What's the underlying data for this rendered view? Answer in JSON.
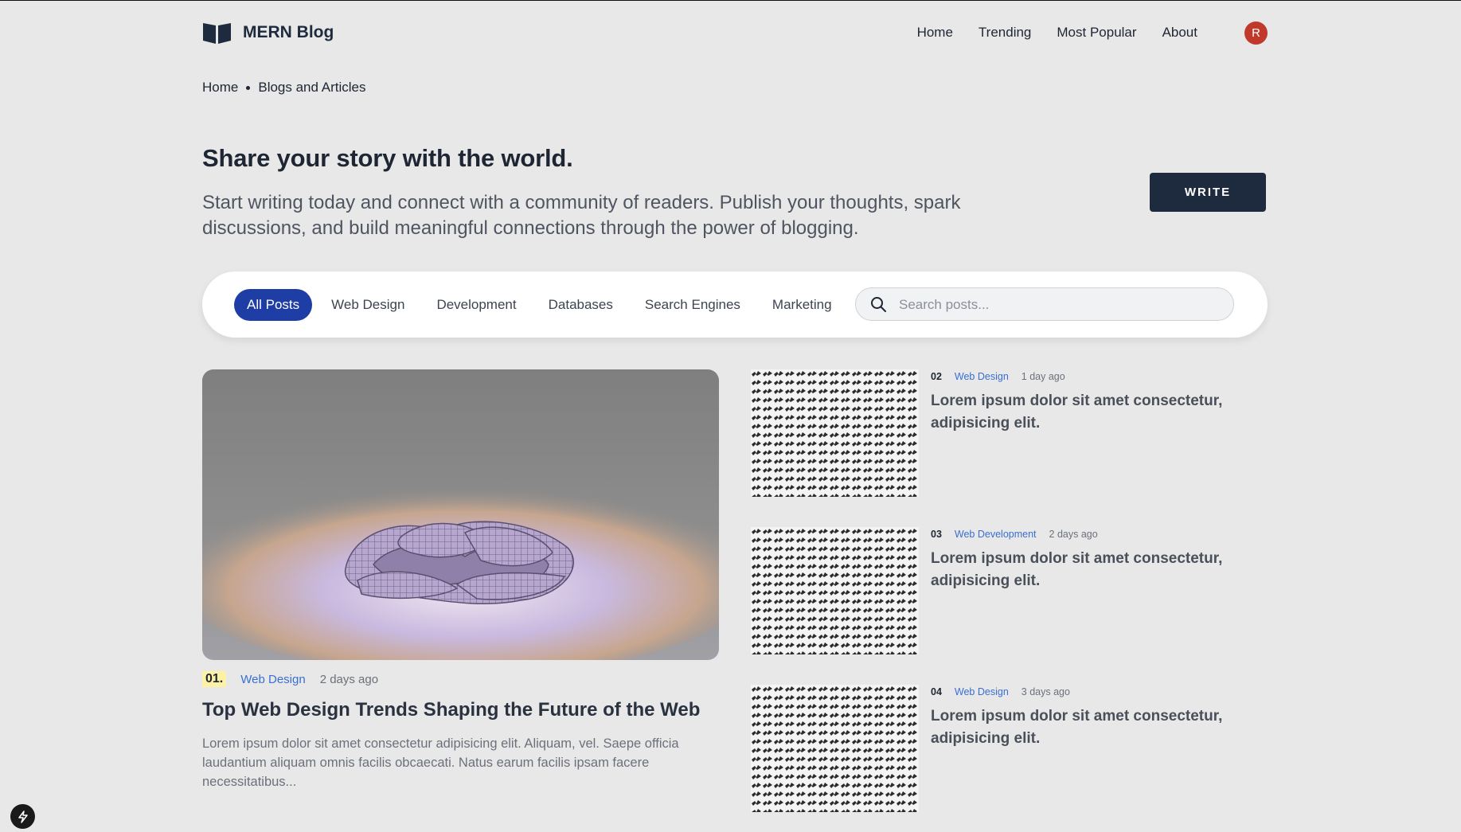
{
  "brand": {
    "name": "MERN Blog",
    "logo_icon": "open-book-icon"
  },
  "nav": {
    "items": [
      "Home",
      "Trending",
      "Most Popular",
      "About"
    ]
  },
  "user": {
    "avatar_initial": "R",
    "avatar_color": "#c0392b"
  },
  "breadcrumb": {
    "home": "Home",
    "current": "Blogs and Articles"
  },
  "hero": {
    "title": "Share your story with the world.",
    "subtitle": "Start writing today and connect with a community of readers. Publish your thoughts, spark discussions, and build meaningful connections through the power of blogging.",
    "write_button": "WRITE"
  },
  "filters": {
    "categories": [
      "All Posts",
      "Web Design",
      "Development",
      "Databases",
      "Search Engines",
      "Marketing"
    ],
    "active": "All Posts",
    "search_placeholder": "Search posts..."
  },
  "featured": {
    "number": "01.",
    "category": "Web Design",
    "time": "2 days ago",
    "title": "Top Web Design Trends Shaping the Future of the Web",
    "excerpt": "Lorem ipsum dolor sit amet consectetur adipisicing elit. Aliquam, vel. Saepe officia laudantium aliquam omnis facilis obcaecati. Natus earum facilis ipsam facere necessitatibus..."
  },
  "side_posts": [
    {
      "number": "02",
      "category": "Web Design",
      "time": "1 day ago",
      "title": "Lorem ipsum dolor sit amet consectetur, adipisicing elit."
    },
    {
      "number": "03",
      "category": "Web Development",
      "time": "2 days ago",
      "title": "Lorem ipsum dolor sit amet consectetur, adipisicing elit."
    },
    {
      "number": "04",
      "category": "Web Design",
      "time": "3 days ago",
      "title": "Lorem ipsum dolor sit amet consectetur, adipisicing elit."
    }
  ],
  "colors": {
    "accent": "#1e3ea6",
    "dark": "#1e2a3d",
    "link": "#3a6fd1",
    "badge": "#fdf1a6"
  }
}
